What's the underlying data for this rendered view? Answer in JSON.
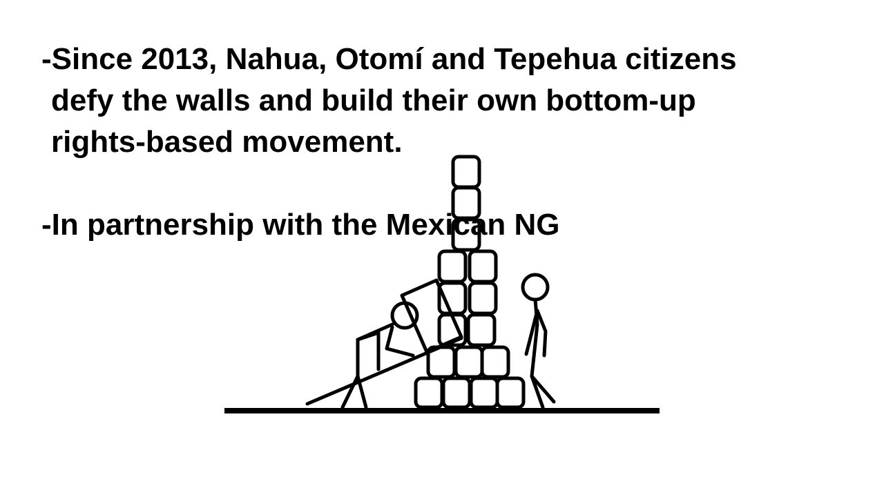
{
  "slide": {
    "bullet1": {
      "line1": "-Since 2013, Nahua, Otomí and Tepehua citizens",
      "line2": "defy the walls and build their own bottom-up",
      "line3": "rights-based movement."
    },
    "bullet2": {
      "line1": "-In partnership with the Mexican NG"
    },
    "colors": {
      "text": "#000000",
      "background": "#ffffff",
      "drawing": "#000000"
    }
  }
}
